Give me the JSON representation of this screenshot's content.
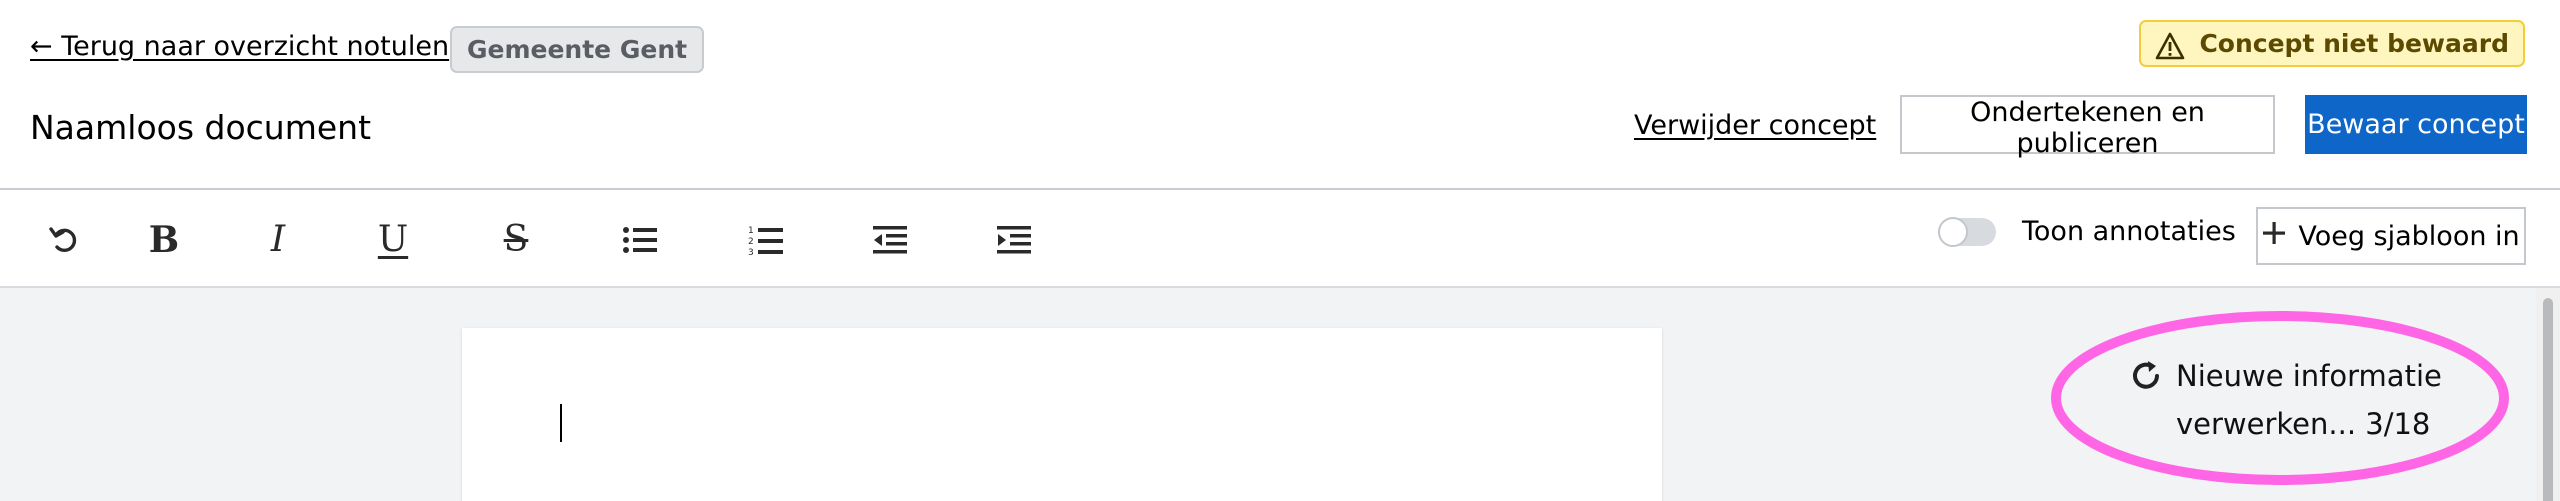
{
  "header": {
    "back_link": "← Terug naar overzicht notulen",
    "organization": "Gemeente Gent",
    "unsaved_status": "Concept niet bewaard",
    "document_title": "Naamloos document",
    "delete_label": "Verwijder concept",
    "sign_label": "Ondertekenen en publiceren",
    "save_label": "Bewaar concept"
  },
  "toolbar": {
    "buttons": [
      {
        "name": "undo",
        "icon": "undo-icon"
      },
      {
        "name": "bold",
        "icon": "bold-icon",
        "glyph": "B"
      },
      {
        "name": "italic",
        "icon": "italic-icon",
        "glyph": "I"
      },
      {
        "name": "underline",
        "icon": "underline-icon",
        "glyph": "U"
      },
      {
        "name": "strikethrough",
        "icon": "strikethrough-icon",
        "glyph": "S"
      },
      {
        "name": "bullet-list",
        "icon": "bullet-list-icon"
      },
      {
        "name": "numbered-list",
        "icon": "numbered-list-icon"
      },
      {
        "name": "outdent",
        "icon": "outdent-icon"
      },
      {
        "name": "indent",
        "icon": "indent-icon"
      }
    ],
    "annotations_toggle_label": "Toon annotaties",
    "annotations_on": false,
    "template_button_label": "Voeg sjabloon in"
  },
  "status": {
    "line1": "Nieuwe informatie",
    "line2": "verwerken... 3/18",
    "highlight_color": "#ff66e6"
  },
  "colors": {
    "primary": "#0e66c9",
    "warning_bg": "#fff6bf",
    "warning_border": "#f2cf3a"
  }
}
